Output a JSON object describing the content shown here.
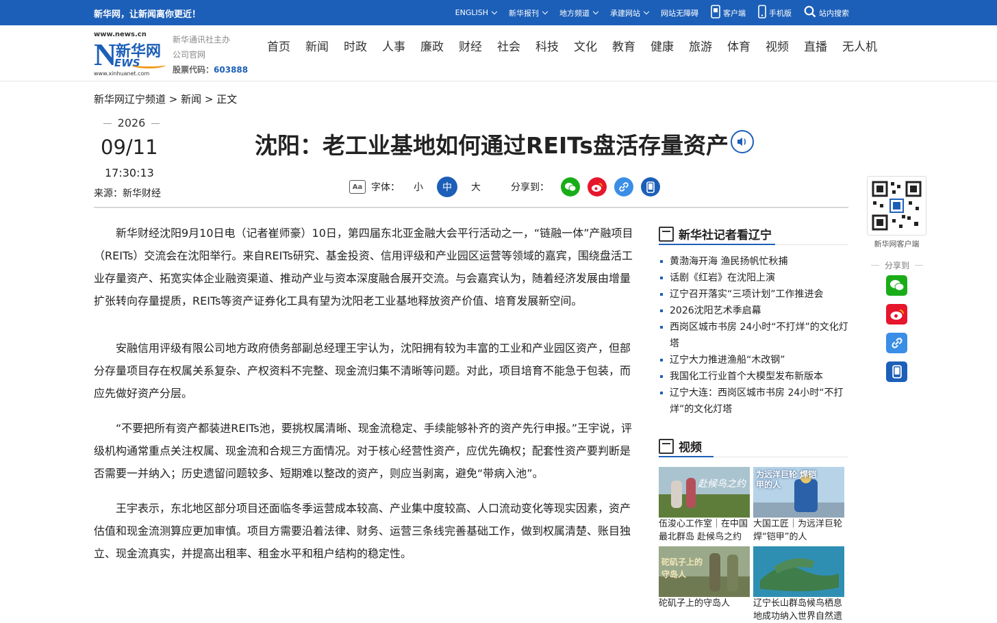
{
  "topbar": {
    "slogan": "新华网，让新闻离你更近！",
    "items": [
      {
        "label": "ENGLISH",
        "dropdown": true
      },
      {
        "label": "新华报刊",
        "dropdown": true
      },
      {
        "label": "地方频道",
        "dropdown": true
      },
      {
        "label": "承建网站",
        "dropdown": true
      },
      {
        "label": "网站无障碍",
        "dropdown": false
      },
      {
        "label": "客户端",
        "icon": "phone-icon"
      },
      {
        "label": "手机版",
        "icon": "mobile-icon"
      },
      {
        "label": "站内搜索",
        "icon": "search-icon"
      }
    ]
  },
  "header": {
    "logo": {
      "url_top": "www.news.cn",
      "cn": "新华网",
      "en": "EWS",
      "url_bottom": "www.xinhuanet.com"
    },
    "info_line1": "新华通讯社主办",
    "info_line2": "公司官网",
    "stock_label": "股票代码：",
    "stock_code": "603888",
    "nav": [
      "首页",
      "新闻",
      "时政",
      "人事",
      "廉政",
      "财经",
      "社会",
      "科技",
      "文化",
      "教育",
      "健康",
      "旅游",
      "体育",
      "视频",
      "直播",
      "无人机"
    ]
  },
  "breadcrumb": "新华网辽宁频道 > 新闻 > 正文",
  "date": {
    "year": "2026",
    "month_day": "09/11",
    "time": "17:30:13"
  },
  "source": "来源：新华财经",
  "title": "沈阳：老工业基地如何通过REITs盘活存量资产",
  "toolbar": {
    "font_label": "字体：",
    "font_small": "小",
    "font_medium": "中",
    "font_large": "大",
    "share_label": "分享到："
  },
  "article": {
    "paragraphs": [
      "新华财经沈阳9月10日电（记者崔师豪）10日，第四届东北亚金融大会平行活动之一，“链融一体”产融项目（REITs）交流会在沈阳举行。来自REITs研究、基金投资、信用评级和产业园区运营等领域的嘉宾，围绕盘活工业存量资产、拓宽实体企业融资渠道、推动产业与资本深度融合展开交流。与会嘉宾认为，随着经济发展由增量扩张转向存量提质，REITs等资产证券化工具有望为沈阳老工业基地释放资产价值、培育发展新空间。",
      "安融信用评级有限公司地方政府债务部副总经理王宇认为，沈阳拥有较为丰富的工业和产业园区资产，但部分存量项目存在权属关系复杂、产权资料不完整、现金流归集不清晰等问题。对此，项目培育不能急于包装，而应先做好资产分层。",
      "“不要把所有资产都装进REITs池，要挑权属清晰、现金流稳定、手续能够补齐的资产先行申报。”王宇说，评级机构通常重点关注权属、现金流和合规三方面情况。对于核心经营性资产，应优先确权；配套性资产要判断是否需要一并纳入；历史遗留问题较多、短期难以整改的资产，则应当剥离，避免“带病入池”。",
      "王宇表示，东北地区部分项目还面临冬季运营成本较高、产业集中度较高、人口流动变化等现实因素，资产估值和现金流测算应更加审慎。项目方需要沿着法律、财务、运营三条线完善基础工作，做到权属清楚、账目独立、现金流真实，并提高出租率、租金水平和租户结构的稳定性。"
    ]
  },
  "sidebar": {
    "reporters_title": "新华社记者看辽宁",
    "news": [
      "黄渤海开海 渔民扬帆忙秋捕",
      "话剧《红岩》在沈阳上演",
      "辽宁召开落实“三项计划”工作推进会",
      "2026沈阳艺术季启幕",
      "西岗区城市书房 24小时“不打烊”的文化灯塔",
      "辽宁大力推进渔船“木改钢”",
      "我国化工行业首个大模型发布新版本",
      "辽宁大连：西岗区城市书房 24小时“不打烊”的文化灯塔"
    ],
    "video_title": "视频",
    "videos": [
      {
        "caption": "伍浚心工作室｜在中国最北群岛 赴候鸟之约",
        "thumb_text": "赴候鸟之约"
      },
      {
        "caption": "大国工匠｜为远洋巨轮焊“铠甲”的人",
        "thumb_text": "为远洋巨轮 焊铠甲的人"
      },
      {
        "caption": "砣矶子上的守岛人",
        "thumb_text": "砣矶子上的 守岛人"
      },
      {
        "caption": "辽宁长山群岛候鸟栖息地成功纳入世界自然遗",
        "thumb_text": ""
      }
    ]
  },
  "float_panel": {
    "qr_label": "新华网客户端",
    "share_label": "分享到"
  },
  "colors": {
    "brand_blue": "#1c5fb8",
    "wechat": "#1aad19",
    "weibo": "#e6162d",
    "link": "#3a8ee6",
    "phone": "#1c5fb8"
  }
}
